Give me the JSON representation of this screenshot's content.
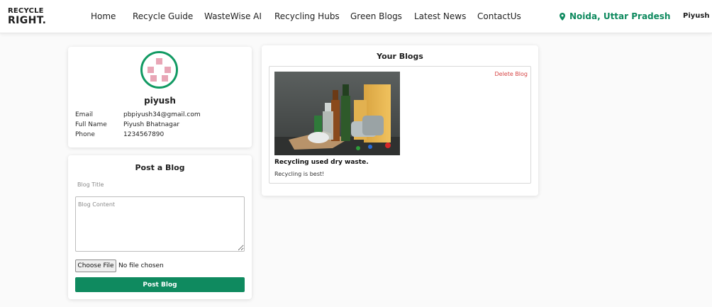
{
  "brand": {
    "line1": "RECYCLE",
    "line2": "RIGHT."
  },
  "nav": {
    "links": [
      "Home",
      "Recycle Guide",
      "WasteWise AI",
      "Recycling Hubs",
      "Green Blogs",
      "Latest News",
      "ContactUs"
    ],
    "location": "Noida, Uttar Pradesh",
    "location_icon": "map-pin-icon",
    "user": "Piyush"
  },
  "profile": {
    "name": "piyush",
    "fields": [
      {
        "label": "Email",
        "value": "pbpiyush34@gmail.com"
      },
      {
        "label": "Full Name",
        "value": "Piyush Bhatnagar"
      },
      {
        "label": "Phone",
        "value": "1234567890"
      }
    ]
  },
  "post_form": {
    "heading": "Post a Blog",
    "title_placeholder": "Blog Title",
    "content_placeholder": "Blog Content",
    "file_button": "Choose File",
    "file_status": "No file chosen",
    "submit_label": "Post Blog"
  },
  "blogs": {
    "heading": "Your Blogs",
    "items": [
      {
        "title": "Recycling used dry waste.",
        "content": "Recycling is best!",
        "delete_label": "Delete Blog"
      }
    ]
  },
  "colors": {
    "brand_green": "#0f8a5f",
    "avatar_ring": "#129a63",
    "delete_red": "#d64545",
    "avatar_pattern": "#e8a6b6"
  }
}
